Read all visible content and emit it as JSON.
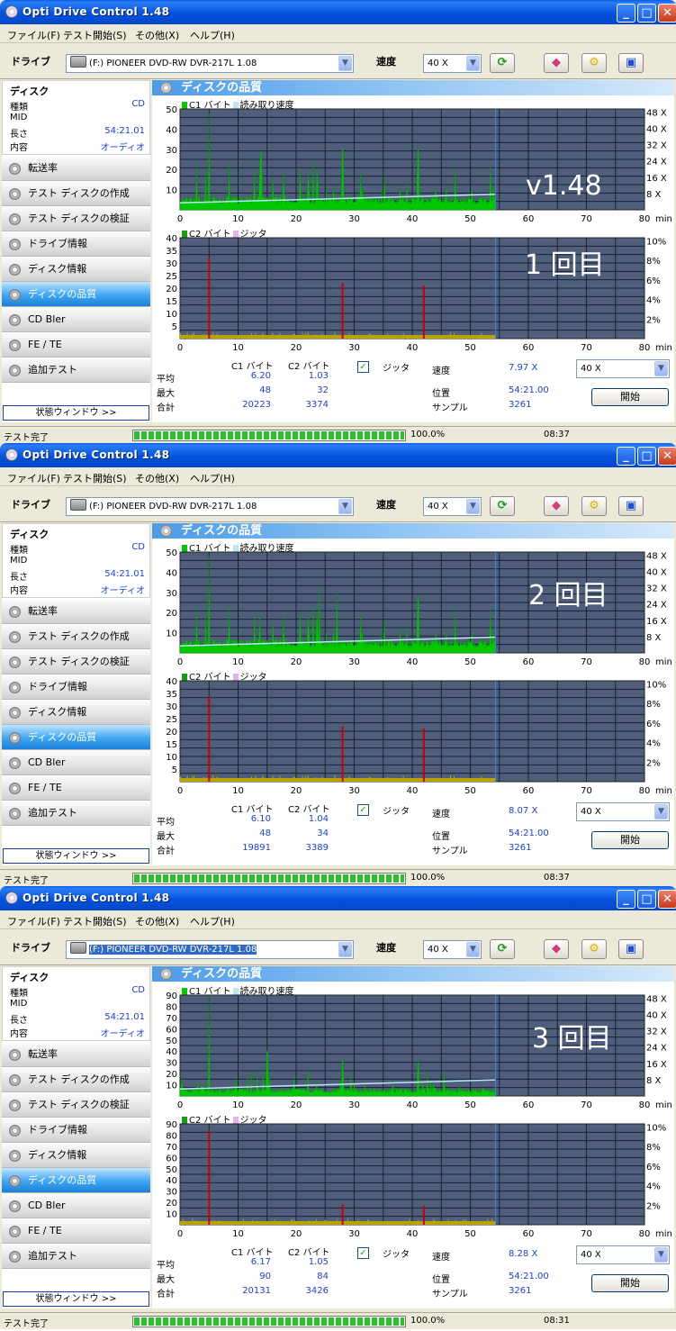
{
  "colors": {
    "c1": "#00c800",
    "readspeed": "#bfe3f8",
    "c2": "#c80000",
    "jitter": "#b8a400",
    "plotbg": "#4e5e7b",
    "grid": "#1a2233"
  },
  "icons": [
    "app-disc-icon",
    "refresh-icon",
    "eraser-icon",
    "gears-icon",
    "save-icon",
    "drive-icon",
    "disc-icon"
  ],
  "windows": [
    {
      "title": "Opti Drive Control 1.48",
      "menu": [
        "ファイル(F)",
        "テスト開始(S)",
        "その他(X)",
        "ヘルプ(H)"
      ],
      "drive_label": "ドライブ",
      "drive_value": "(F:)    PIONEER DVD-RW  DVR-217L 1.08",
      "speed_label": "速度",
      "speed_value": "40 X",
      "disc": {
        "title": "ディスク",
        "rows": [
          [
            "種類",
            "CD"
          ],
          [
            "MID",
            ""
          ],
          [
            "長さ",
            "54:21.01"
          ],
          [
            "内容",
            "オーディオ"
          ]
        ]
      },
      "nav": [
        "転送率",
        "テスト ディスクの作成",
        "テスト ディスクの検証",
        "ドライブ情報",
        "ディスク情報",
        "ディスクの品質",
        "CD Bler",
        "FE / TE",
        "追加テスト"
      ],
      "nav_active": 5,
      "status_button": "状態ウィンドウ >>",
      "section_title": "ディスクの品質",
      "overlay_lines": [
        "v1.48",
        "1 回目"
      ],
      "top_legend": [
        "C1 バイト",
        "読み取り速度"
      ],
      "bottom_legend": [
        "C2 バイト",
        "ジッタ"
      ],
      "stats": {
        "col_c1": "C1 バイト",
        "col_c2": "C2 バイト",
        "labels": [
          "平均",
          "最大",
          "合計"
        ],
        "c1": [
          "6.20",
          "48",
          "20223"
        ],
        "c2": [
          "1.03",
          "32",
          "3374"
        ],
        "jitter_label": "ジッタ",
        "speed_label": "速度",
        "speed_value": "7.97 X",
        "pos_label": "位置",
        "pos_value": "54:21.00",
        "sample_label": "サンプル",
        "sample_value": "3261",
        "speed_select": "40 X",
        "start": "開始"
      },
      "statusbar": {
        "text": "テスト完了",
        "percent": "100.0%",
        "time": "08:37"
      }
    },
    {
      "title": "Opti Drive Control 1.48",
      "menu": [
        "ファイル(F)",
        "テスト開始(S)",
        "その他(X)",
        "ヘルプ(H)"
      ],
      "drive_label": "ドライブ",
      "drive_value": "(F:)    PIONEER DVD-RW  DVR-217L 1.08",
      "speed_label": "速度",
      "speed_value": "40 X",
      "disc": {
        "title": "ディスク",
        "rows": [
          [
            "種類",
            "CD"
          ],
          [
            "MID",
            ""
          ],
          [
            "長さ",
            "54:21.01"
          ],
          [
            "内容",
            "オーディオ"
          ]
        ]
      },
      "nav": [
        "転送率",
        "テスト ディスクの作成",
        "テスト ディスクの検証",
        "ドライブ情報",
        "ディスク情報",
        "ディスクの品質",
        "CD Bler",
        "FE / TE",
        "追加テスト"
      ],
      "nav_active": 5,
      "status_button": "状態ウィンドウ >>",
      "section_title": "ディスクの品質",
      "overlay_lines": [
        "2 回目"
      ],
      "top_legend": [
        "C1 バイト",
        "読み取り速度"
      ],
      "bottom_legend": [
        "C2 バイト",
        "ジッタ"
      ],
      "stats": {
        "col_c1": "C1 バイト",
        "col_c2": "C2 バイト",
        "labels": [
          "平均",
          "最大",
          "合計"
        ],
        "c1": [
          "6.10",
          "48",
          "19891"
        ],
        "c2": [
          "1.04",
          "34",
          "3389"
        ],
        "jitter_label": "ジッタ",
        "speed_label": "速度",
        "speed_value": "8.07 X",
        "pos_label": "位置",
        "pos_value": "54:21.00",
        "sample_label": "サンプル",
        "sample_value": "3261",
        "speed_select": "40 X",
        "start": "開始"
      },
      "statusbar": {
        "text": "テスト完了",
        "percent": "100.0%",
        "time": "08:37"
      }
    },
    {
      "title": "Opti Drive Control 1.48",
      "menu": [
        "ファイル(F)",
        "テスト開始(S)",
        "その他(X)",
        "ヘルプ(H)"
      ],
      "drive_label": "ドライブ",
      "drive_value": "(F:)    PIONEER DVD-RW  DVR-217L 1.08",
      "speed_label": "速度",
      "speed_value": "40 X",
      "disc": {
        "title": "ディスク",
        "rows": [
          [
            "種類",
            "CD"
          ],
          [
            "MID",
            ""
          ],
          [
            "長さ",
            "54:21.01"
          ],
          [
            "内容",
            "オーディオ"
          ]
        ]
      },
      "nav": [
        "転送率",
        "テスト ディスクの作成",
        "テスト ディスクの検証",
        "ドライブ情報",
        "ディスク情報",
        "ディスクの品質",
        "CD Bler",
        "FE / TE",
        "追加テスト"
      ],
      "nav_active": 5,
      "status_button": "状態ウィンドウ >>",
      "section_title": "ディスクの品質",
      "overlay_lines": [
        "3 回目"
      ],
      "top_legend": [
        "C1 バイト",
        "読み取り速度"
      ],
      "bottom_legend": [
        "C2 バイト",
        "ジッタ"
      ],
      "stats": {
        "col_c1": "C1 バイト",
        "col_c2": "C2 バイト",
        "labels": [
          "平均",
          "最大",
          "合計"
        ],
        "c1": [
          "6.17",
          "90",
          "20131"
        ],
        "c2": [
          "1.05",
          "84",
          "3426"
        ],
        "jitter_label": "ジッタ",
        "speed_label": "速度",
        "speed_value": "8.28 X",
        "pos_label": "位置",
        "pos_value": "54:21.00",
        "sample_label": "サンプル",
        "sample_value": "3261",
        "speed_select": "40 X",
        "start": "開始"
      },
      "statusbar": {
        "text": "テスト完了",
        "percent": "100.0%",
        "time": "08:31"
      }
    }
  ],
  "chart_data": [
    {
      "type": "area",
      "series": [
        {
          "name": "C1 バイト",
          "avg": 6.2,
          "max": 48,
          "spikes": [
            [
              5,
              48
            ],
            [
              28,
              30
            ],
            [
              41,
              30
            ],
            [
              14,
              29
            ]
          ]
        },
        {
          "name": "読み取り速度",
          "start_x": 3.6,
          "end_x": 8.0
        }
      ],
      "xlim": [
        0,
        80
      ],
      "ylim": [
        0,
        50
      ],
      "yticks": [
        10,
        20,
        30,
        40,
        50
      ],
      "y2ticks": [
        "8 X",
        "16 X",
        "24 X",
        "32 X",
        "40 X",
        "48 X"
      ],
      "xticks": [
        0,
        10,
        20,
        30,
        40,
        50,
        60,
        70,
        80
      ],
      "x_unit": "min",
      "data_end": 54.35
    },
    {
      "type": "bar",
      "series": [
        {
          "name": "C2 バイト",
          "max": 32,
          "spikes": [
            [
              5,
              32
            ],
            [
              28,
              22
            ],
            [
              42,
              21
            ]
          ]
        },
        {
          "name": "ジッタ"
        }
      ],
      "xlim": [
        0,
        80
      ],
      "ylim": [
        0,
        40
      ],
      "yticks": [
        5,
        10,
        15,
        20,
        25,
        30,
        35,
        40
      ],
      "y2ticks": [
        "2%",
        "4%",
        "6%",
        "8%",
        "10%"
      ],
      "xticks": [
        0,
        10,
        20,
        30,
        40,
        50,
        60,
        70,
        80
      ],
      "x_unit": "min",
      "data_end": 54.35
    },
    {
      "type": "area",
      "series": [
        {
          "name": "C1 バイト",
          "avg": 6.1,
          "max": 48,
          "spikes": [
            [
              5,
              48
            ],
            [
              24,
              34
            ],
            [
              27,
              30
            ],
            [
              41,
              28
            ]
          ]
        },
        {
          "name": "読み取り速度",
          "start_x": 3.6,
          "end_x": 8.1
        }
      ],
      "xlim": [
        0,
        80
      ],
      "ylim": [
        0,
        50
      ],
      "yticks": [
        10,
        20,
        30,
        40,
        50
      ],
      "y2ticks": [
        "8 X",
        "16 X",
        "24 X",
        "32 X",
        "40 X",
        "48 X"
      ],
      "xticks": [
        0,
        10,
        20,
        30,
        40,
        50,
        60,
        70,
        80
      ],
      "x_unit": "min",
      "data_end": 54.35
    },
    {
      "type": "bar",
      "series": [
        {
          "name": "C2 バイト",
          "max": 34,
          "spikes": [
            [
              5,
              34
            ],
            [
              28,
              22
            ],
            [
              42,
              21
            ]
          ]
        },
        {
          "name": "ジッタ"
        }
      ],
      "xlim": [
        0,
        80
      ],
      "ylim": [
        0,
        40
      ],
      "yticks": [
        5,
        10,
        15,
        20,
        25,
        30,
        35,
        40
      ],
      "y2ticks": [
        "2%",
        "4%",
        "6%",
        "8%",
        "10%"
      ],
      "xticks": [
        0,
        10,
        20,
        30,
        40,
        50,
        60,
        70,
        80
      ],
      "x_unit": "min",
      "data_end": 54.35
    },
    {
      "type": "area",
      "series": [
        {
          "name": "C1 バイト",
          "avg": 6.17,
          "max": 90,
          "spikes": [
            [
              5,
              90
            ],
            [
              15,
              40
            ],
            [
              28,
              32
            ],
            [
              41,
              30
            ]
          ]
        },
        {
          "name": "読み取り速度",
          "start_x": 3.6,
          "end_x": 8.3
        }
      ],
      "xlim": [
        0,
        80
      ],
      "ylim": [
        0,
        90
      ],
      "yticks": [
        10,
        20,
        30,
        40,
        50,
        60,
        70,
        80,
        90
      ],
      "y2ticks": [
        "8 X",
        "16 X",
        "24 X",
        "32 X",
        "40 X",
        "48 X"
      ],
      "xticks": [
        0,
        10,
        20,
        30,
        40,
        50,
        60,
        70,
        80
      ],
      "x_unit": "min",
      "data_end": 54.35
    },
    {
      "type": "bar",
      "series": [
        {
          "name": "C2 バイト",
          "max": 84,
          "spikes": [
            [
              5,
              84
            ],
            [
              28,
              18
            ],
            [
              42,
              17
            ]
          ]
        },
        {
          "name": "ジッタ"
        }
      ],
      "xlim": [
        0,
        80
      ],
      "ylim": [
        0,
        90
      ],
      "yticks": [
        10,
        20,
        30,
        40,
        50,
        60,
        70,
        80,
        90
      ],
      "y2ticks": [
        "2%",
        "4%",
        "6%",
        "8%",
        "10%"
      ],
      "xticks": [
        0,
        10,
        20,
        30,
        40,
        50,
        60,
        70,
        80
      ],
      "x_unit": "min",
      "data_end": 54.35
    }
  ]
}
